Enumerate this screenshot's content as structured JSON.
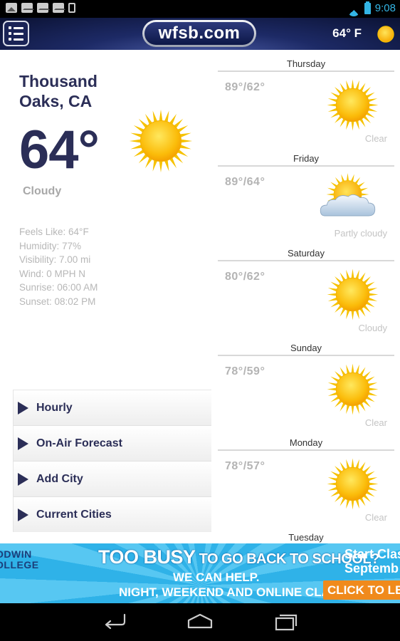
{
  "status_bar": {
    "time": "9:08",
    "icons": [
      "image-icon",
      "mail-icon",
      "mail-icon",
      "mail-icon",
      "phone-icon",
      "wifi-icon",
      "battery-icon"
    ]
  },
  "header": {
    "logo_text": "wfsb.com",
    "current_temp": "64° F",
    "menu_icon": "list-menu-icon",
    "weather_icon": "sun-icon"
  },
  "current": {
    "city": "Thousand Oaks, CA",
    "temperature": "64°",
    "condition": "Cloudy",
    "icon": "sun-icon",
    "details": [
      "Feels Like:  64°F",
      "Humidity: 77%",
      "Visibility: 7.00 mi",
      "Wind: 0 MPH N",
      "Sunrise: 06:00 AM",
      "Sunset: 08:02 PM"
    ]
  },
  "menu": {
    "items": [
      {
        "label": "Hourly"
      },
      {
        "label": "On-Air Forecast"
      },
      {
        "label": "Add City"
      },
      {
        "label": "Current Cities"
      }
    ]
  },
  "forecast": {
    "days": [
      {
        "day": "Thursday",
        "temps": "89°/62°",
        "condition": "Clear",
        "icon": "sun-icon"
      },
      {
        "day": "Friday",
        "temps": "89°/64°",
        "condition": "Partly cloudy",
        "icon": "partly-cloudy-icon"
      },
      {
        "day": "Saturday",
        "temps": "80°/62°",
        "condition": "Cloudy",
        "icon": "sun-icon"
      },
      {
        "day": "Sunday",
        "temps": "78°/59°",
        "condition": "Clear",
        "icon": "sun-icon"
      },
      {
        "day": "Monday",
        "temps": "78°/57°",
        "condition": "Clear",
        "icon": "sun-icon"
      },
      {
        "day": "Tuesday"
      }
    ]
  },
  "ad": {
    "left_text": "ODWIN OLLEGE",
    "headline_big": "TOO BUSY",
    "headline_rest": " TO GO BACK TO SCHOOL?",
    "sub1": "WE CAN HELP.",
    "sub2": "NIGHT, WEEKEND AND ONLINE CLASSES",
    "right_line1": "Start Clas",
    "right_line2": "Septemb",
    "cta": "CLICK TO LEARN"
  },
  "nav": {
    "back_icon": "back-icon",
    "home_icon": "home-icon",
    "recents_icon": "recent-apps-icon"
  }
}
